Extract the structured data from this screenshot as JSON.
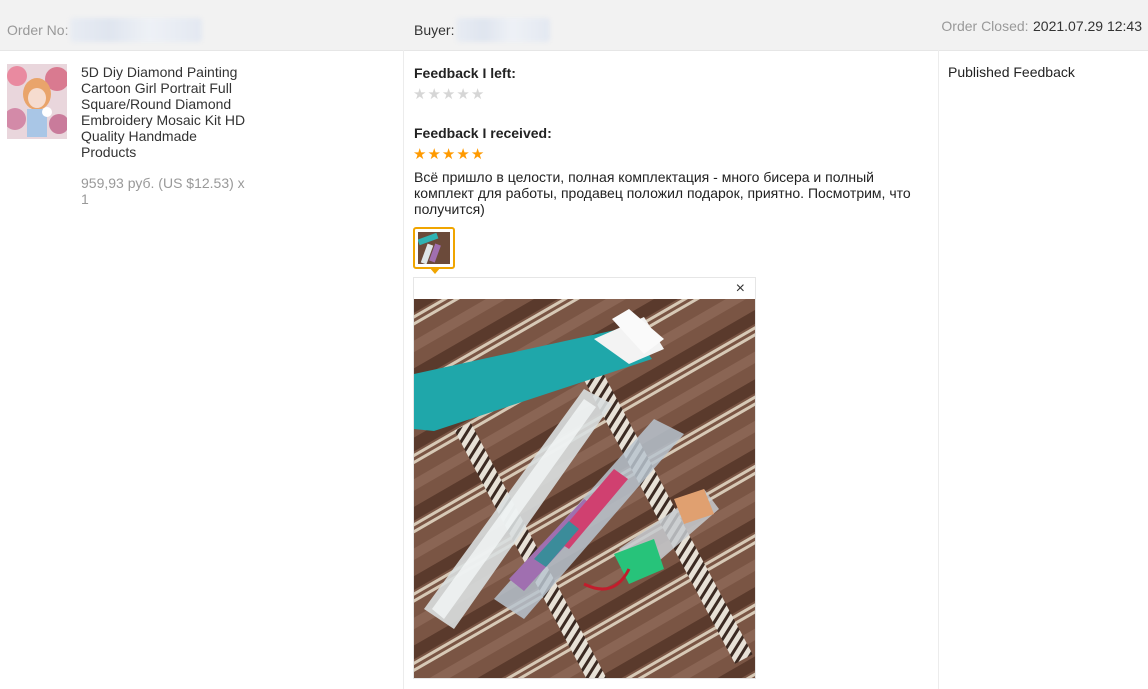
{
  "header": {
    "order_label": "Order No:",
    "buyer_label": "Buyer:",
    "closed_label": "Order Closed:",
    "closed_value": "2021.07.29 12:43"
  },
  "product": {
    "title": "5D Diy Diamond Painting Cartoon Girl Portrait Full Square/Round Diamond Embroidery Mosaic Kit HD Quality Handmade Products",
    "price": "959,93 руб. (US $12.53) x 1",
    "image": "product-thumbnail"
  },
  "feedback": {
    "left_heading": "Feedback I left:",
    "left_rating": 0,
    "received_heading": "Feedback I received:",
    "received_rating": 5,
    "received_text": "Всё пришло в целости, полная комплектация - много бисера и полный комплект для работы, продавец положил подарок, приятно. Посмотрим, что получится)",
    "photo_viewer_close": "×"
  },
  "status": {
    "label": "Published Feedback"
  },
  "colors": {
    "star_on": "#ff9a00",
    "star_off": "#d6d6d6",
    "thumb_border": "#f0a500",
    "header_bg": "#f2f2f2"
  }
}
